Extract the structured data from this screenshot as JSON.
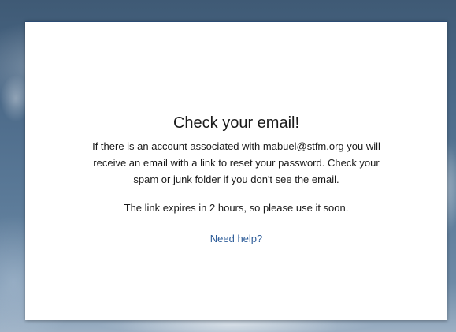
{
  "dialog": {
    "title": "Check your email!",
    "message_lines": [
      "If there is an account associated with mabuel@stfm.org you will",
      "receive an email with a link to reset your password. Check your",
      "spam or junk folder if you don't see the email."
    ],
    "expiry_notice": "The link expires in 2 hours, so please use it soon.",
    "help_link_label": "Need help?"
  },
  "colors": {
    "card_top_border": "#2c4c74",
    "link": "#2f5e9a",
    "text": "#1a1a1a"
  }
}
